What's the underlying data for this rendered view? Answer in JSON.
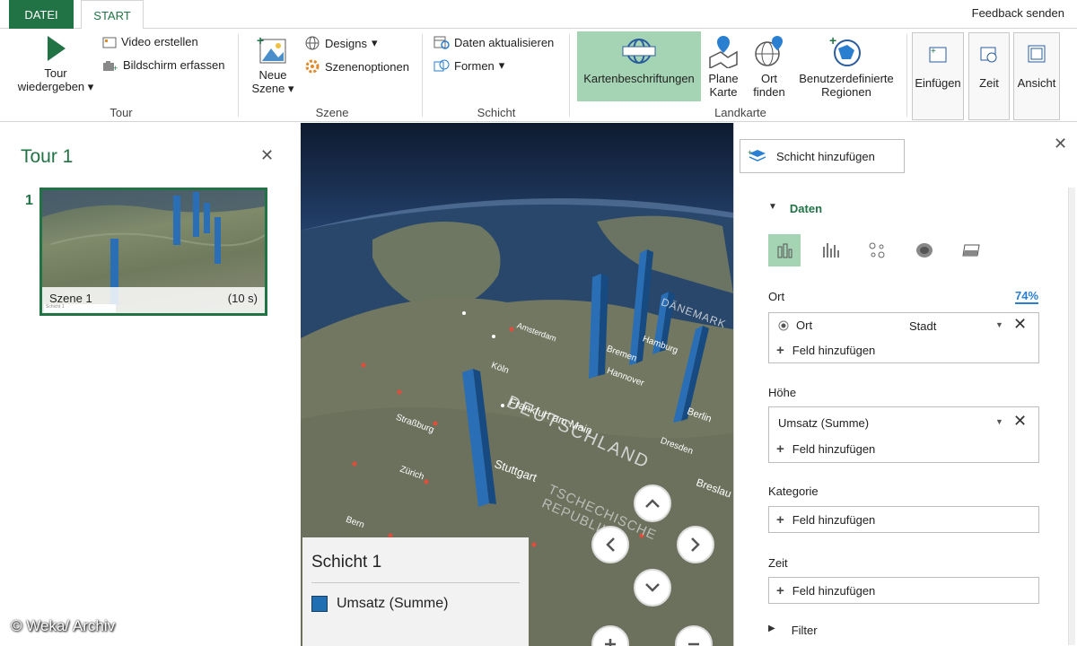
{
  "tabs": {
    "file": "DATEI",
    "start": "START",
    "feedback": "Feedback senden"
  },
  "ribbon": {
    "tour": {
      "play_label_line1": "Tour",
      "play_label_line2": "wiedergeben",
      "video": "Video erstellen",
      "capture": "Bildschirm erfassen",
      "group": "Tour"
    },
    "szene": {
      "new_line1": "Neue",
      "new_line2": "Szene",
      "designs": "Designs",
      "options": "Szenenoptionen",
      "group": "Szene"
    },
    "schicht": {
      "refresh": "Daten aktualisieren",
      "shapes": "Formen",
      "group": "Schicht"
    },
    "landkarte": {
      "labels": "Kartenbeschriftungen",
      "flat_line1": "Plane",
      "flat_line2": "Karte",
      "find_line1": "Ort",
      "find_line2": "finden",
      "regions_line1": "Benutzerdefinierte",
      "regions_line2": "Regionen",
      "group": "Landkarte"
    },
    "extra": {
      "insert": "Einfügen",
      "time": "Zeit",
      "view": "Ansicht"
    }
  },
  "tour_panel": {
    "title": "Tour 1",
    "scene_number": "1",
    "scene_name": "Szene 1",
    "scene_duration": "(10 s)",
    "scene_sub": "Schicht 1"
  },
  "map": {
    "labels": [
      "DEUTSCHLAND",
      "Köln",
      "Frankfurt am Main",
      "Hannover",
      "Bremen",
      "Hamburg",
      "Berlin",
      "Dresden",
      "Breslau",
      "Stuttgart",
      "Zürich",
      "Amsterdam",
      "Straßburg",
      "Bern",
      "TSCHECHISCHE REPUBLIK",
      "DÄNEMARK"
    ],
    "legend_title": "Schicht 1",
    "legend_item": "Umsatz (Summe)",
    "legend_color": "#1f6fb2",
    "bar_color": "#2a6fb5"
  },
  "layer_panel": {
    "add_layer": "Schicht hinzufügen",
    "section": "Daten",
    "ort_label": "Ort",
    "ort_pct": "74%",
    "ort_field": "Ort",
    "ort_type": "Stadt",
    "add_field": "Feld hinzufügen",
    "hoehe_label": "Höhe",
    "hoehe_field": "Umsatz (Summe)",
    "kategorie_label": "Kategorie",
    "zeit_label": "Zeit",
    "filter_label": "Filter"
  },
  "watermark": "© Weka/ Archiv",
  "colors": {
    "accent": "#217346",
    "highlight": "#a5d4b4"
  }
}
